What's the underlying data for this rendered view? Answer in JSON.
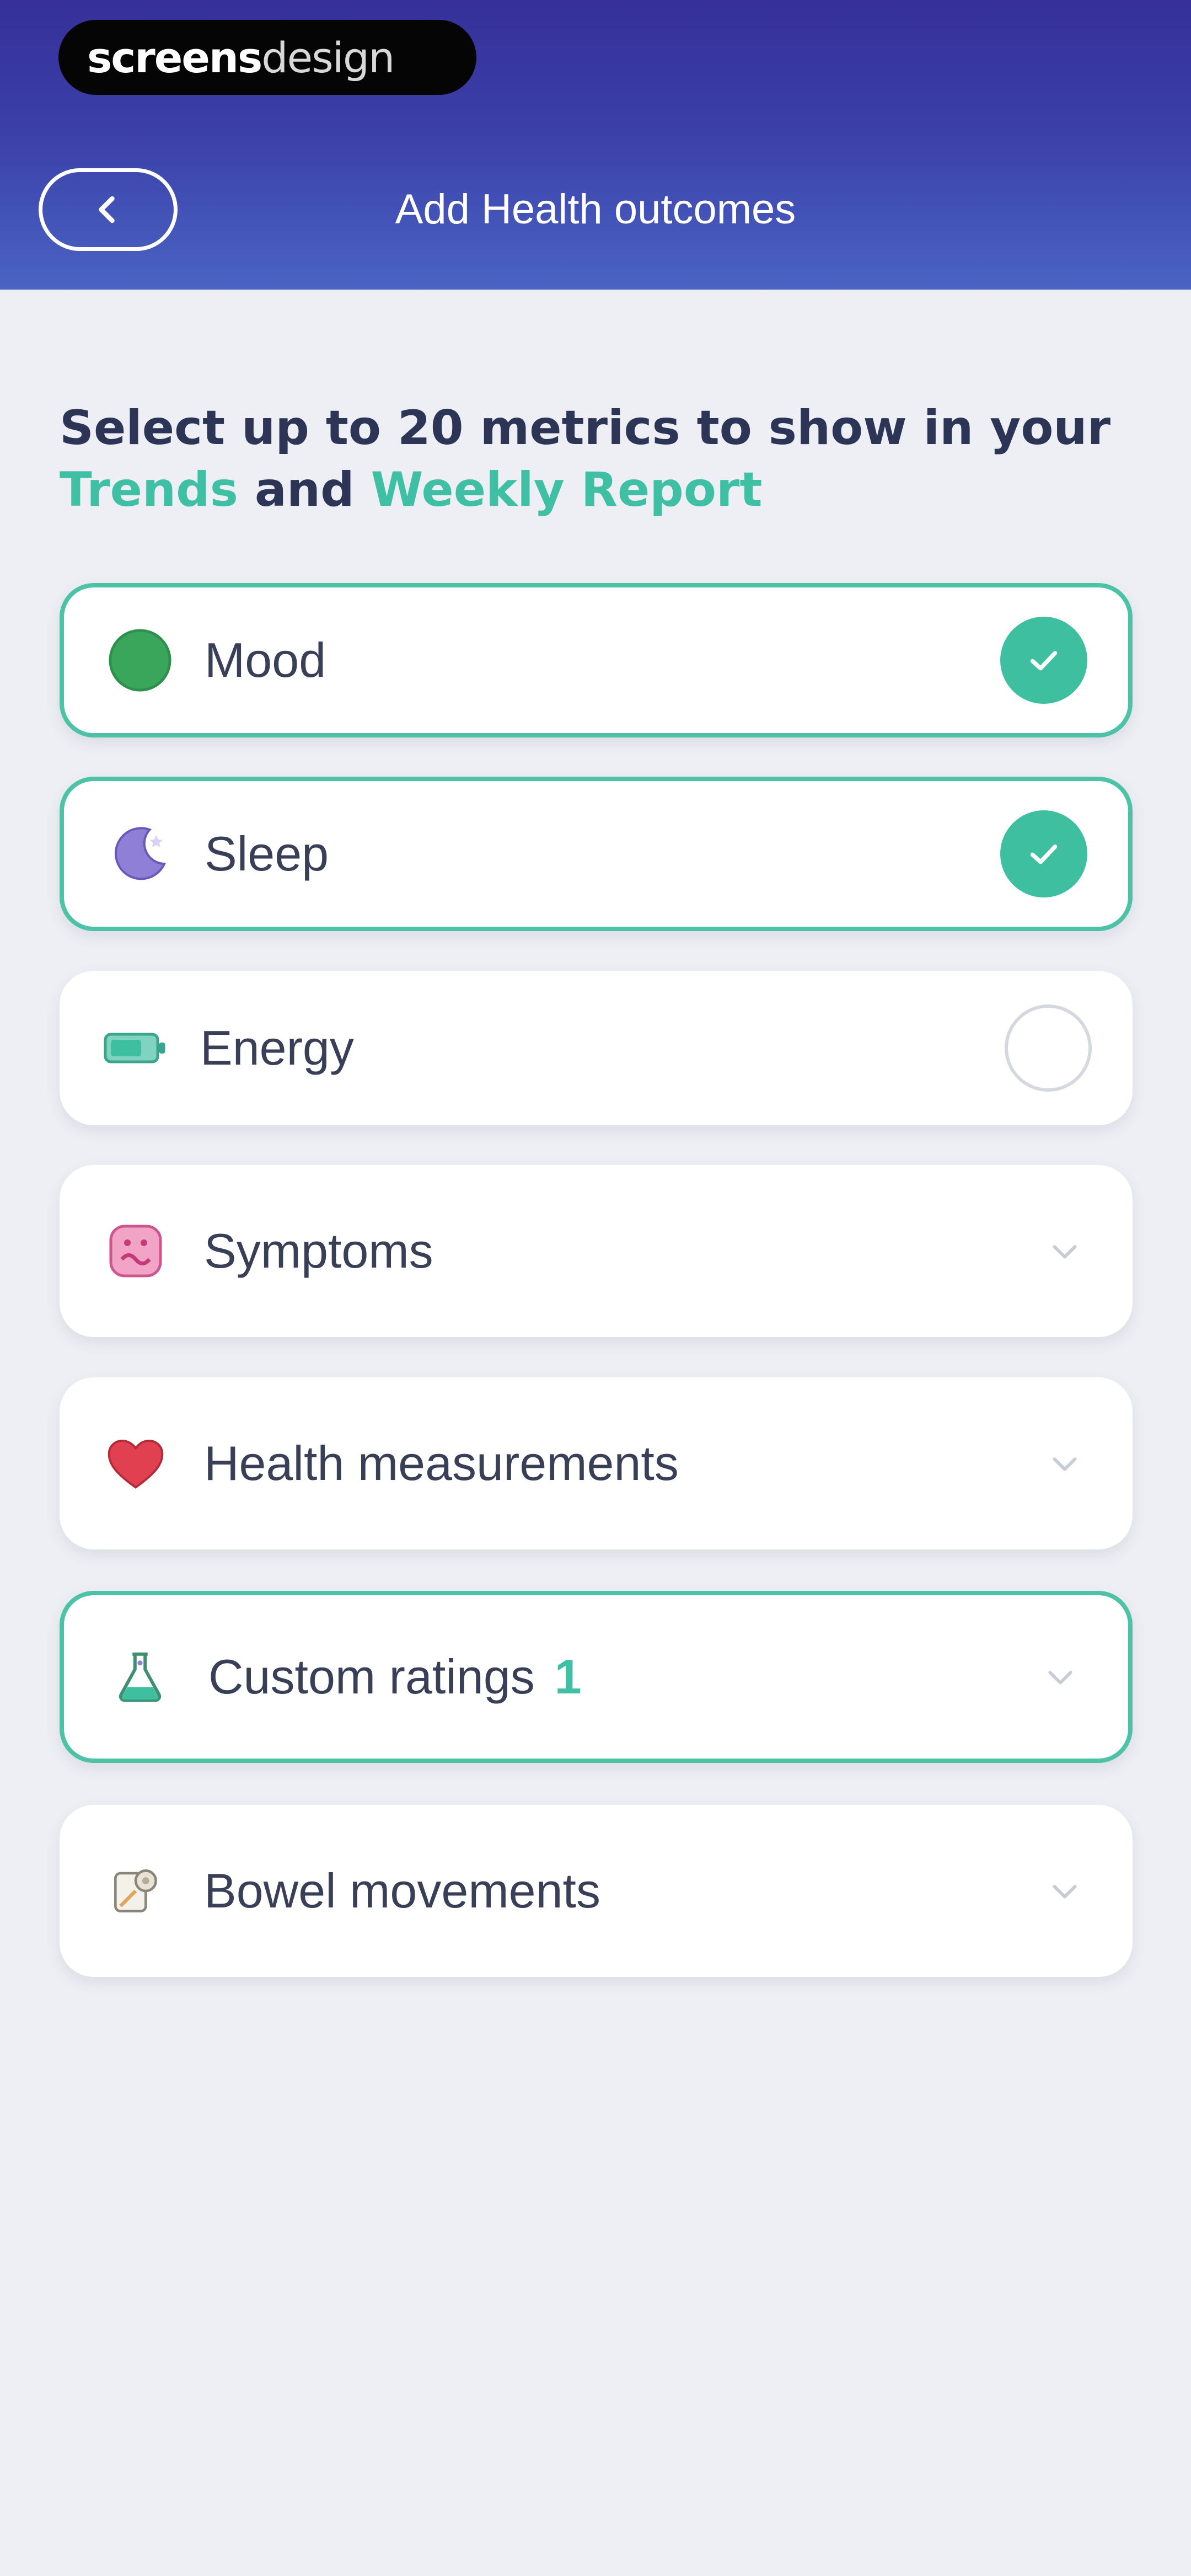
{
  "watermark": {
    "part1": "screens",
    "part2": "design"
  },
  "header": {
    "back_icon": "chevron-left-icon",
    "title": "Add Health outcomes"
  },
  "intro": {
    "line_start": "Select up to 20 metrics to show in your ",
    "highlight_1": "Trends",
    "middle": " and ",
    "highlight_2": "Weekly Report"
  },
  "metrics": [
    {
      "label": "Mood",
      "icon": "mood-face-icon",
      "state": "checked"
    },
    {
      "label": "Sleep",
      "icon": "moon-icon",
      "state": "checked"
    },
    {
      "label": "Energy",
      "icon": "battery-icon",
      "state": "unchecked"
    }
  ],
  "categories": [
    {
      "label": "Symptoms",
      "icon": "symptoms-icon",
      "count": ""
    },
    {
      "label": "Health measurements",
      "icon": "heart-icon",
      "count": ""
    },
    {
      "label": "Custom ratings",
      "icon": "flask-icon",
      "count": "1"
    },
    {
      "label": "Bowel movements",
      "icon": "toilet-paper-icon",
      "count": ""
    }
  ],
  "colors": {
    "header_top": "#36309a",
    "header_bottom": "#4a64c3",
    "accent": "#3fc0a4",
    "background": "#eeeff4",
    "text_dark": "#2c3556"
  }
}
